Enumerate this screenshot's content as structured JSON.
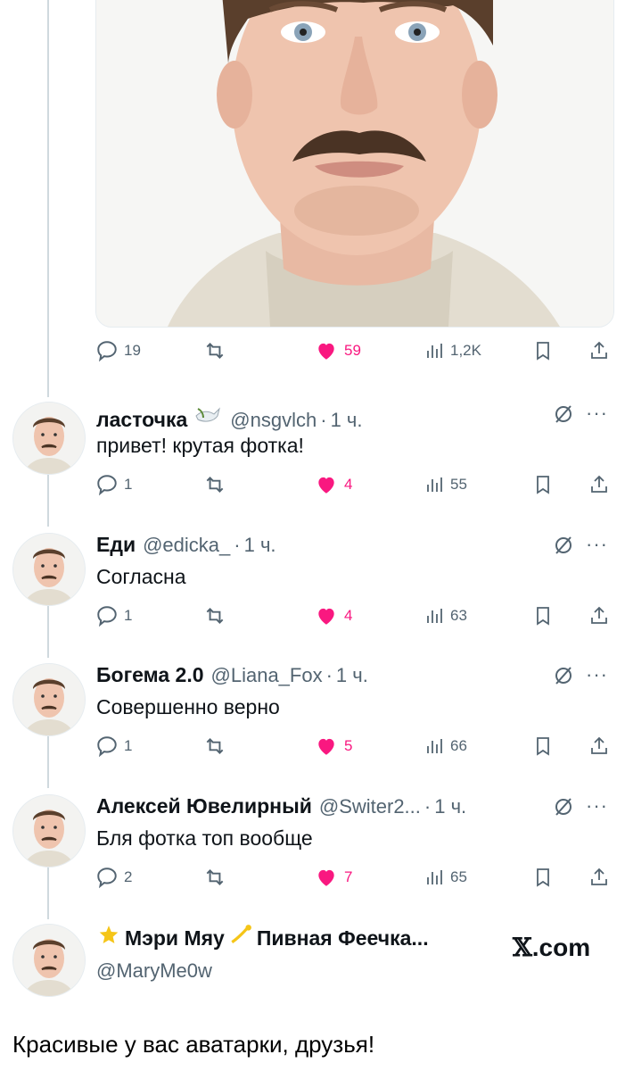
{
  "post": {
    "photo_alt": "portrait photo",
    "stats": {
      "replies": "19",
      "likes": "59",
      "views": "1,2K"
    }
  },
  "replies": [
    {
      "name": "ласточка",
      "handle": "@nsgvlch",
      "time": "1 ч.",
      "text": "привет! крутая фотка!",
      "replies": "1",
      "likes": "4",
      "views": "55",
      "badge": "dove-emoji"
    },
    {
      "name": "Еди",
      "handle": "@edicka_",
      "time": "1 ч.",
      "text": "Согласна",
      "replies": "1",
      "likes": "4",
      "views": "63"
    },
    {
      "name": "Богема 2.0",
      "handle": "@Liana_Fox",
      "time": "1 ч.",
      "text": "Совершенно верно",
      "replies": "1",
      "likes": "5",
      "views": "66"
    },
    {
      "name": "Алексей Ювелирный",
      "handle": "@Switer2...",
      "time": "1 ч.",
      "text": "Бля фотка топ вообще",
      "replies": "2",
      "likes": "7",
      "views": "65"
    }
  ],
  "last_user": {
    "name_part1": "Мэри Мяу",
    "name_part2": "Пивная Феечка...",
    "handle": "@MaryMe0w",
    "emoji1": "star-emoji",
    "emoji2": "dizzy-emoji"
  },
  "watermark": {
    "x": "𝕏",
    "com": ".com"
  },
  "caption": "Красивые у вас аватарки, друзья!",
  "sep": "·",
  "more": "···",
  "colors": {
    "like": "#f91880",
    "muted": "#536471",
    "text": "#0f1419",
    "thread": "#cfd9de"
  }
}
